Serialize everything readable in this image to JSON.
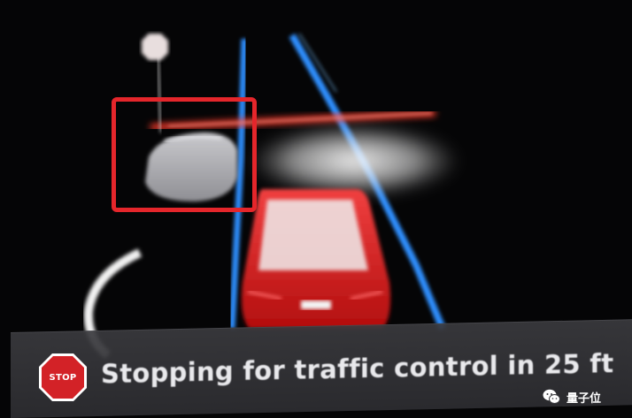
{
  "notice": {
    "message": "Stopping for traffic control in 25 ft",
    "stop_sign_label": "STOP"
  },
  "watermark": {
    "text": "量子位"
  },
  "colors": {
    "lane_line": "#2f8fff",
    "stop_line": "#ff3a2a",
    "ego_car": "#e01b1b",
    "highlight_box": "#e5262b",
    "stop_sign": "#d32227"
  },
  "icons": [
    "stop-sign-icon",
    "traffic-sign-icon",
    "wechat-icon"
  ]
}
